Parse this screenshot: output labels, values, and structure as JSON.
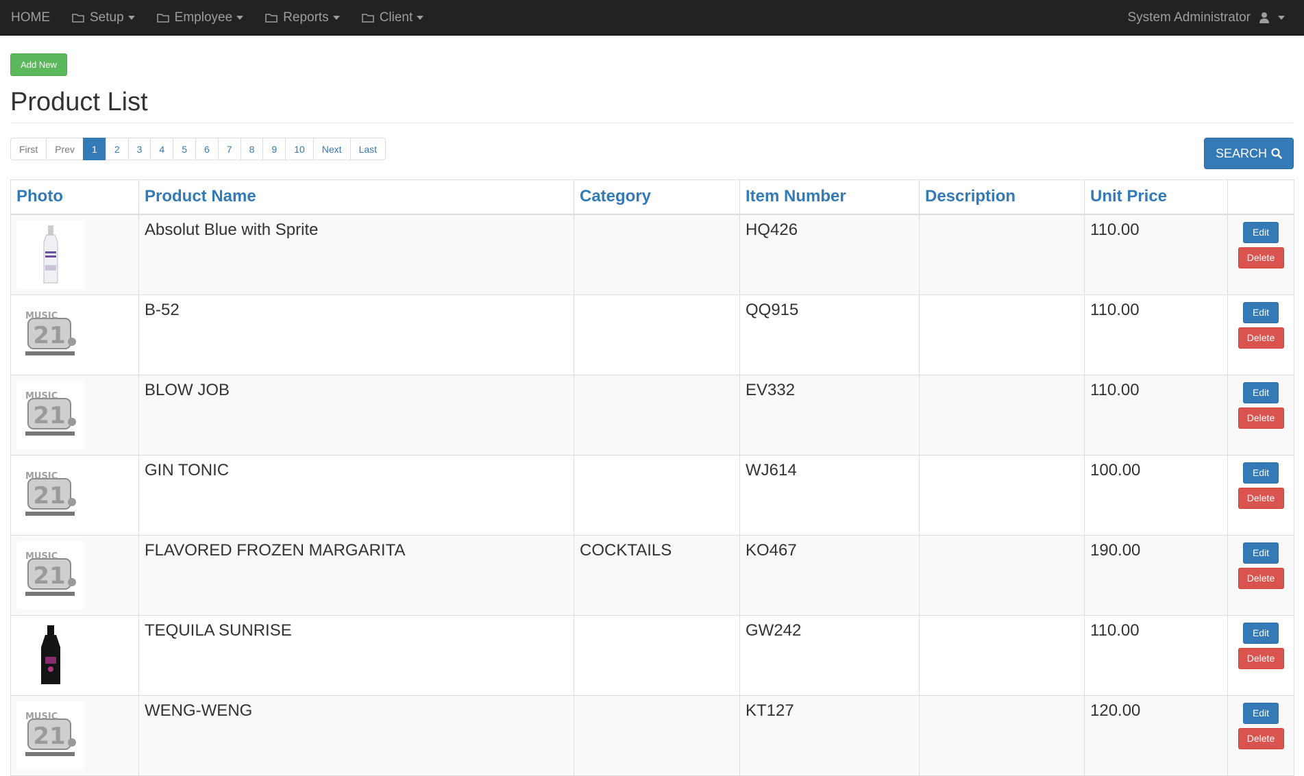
{
  "nav": {
    "home": "HOME",
    "menus": [
      "Setup",
      "Employee",
      "Reports",
      "Client"
    ],
    "user": "System Administrator"
  },
  "add_new": "Add New",
  "page_title": "Product List",
  "pagination": [
    "First",
    "Prev",
    "1",
    "2",
    "3",
    "4",
    "5",
    "6",
    "7",
    "8",
    "9",
    "10",
    "Next",
    "Last"
  ],
  "active_page": "1",
  "search_label": "SEARCH",
  "table": {
    "headers": [
      "Photo",
      "Product Name",
      "Category",
      "Item Number",
      "Description",
      "Unit Price"
    ],
    "rows": [
      {
        "photo": "vodka-bottle",
        "name": "Absolut Blue with Sprite",
        "category": "",
        "item": "HQ426",
        "description": "",
        "price": "110.00"
      },
      {
        "photo": "music21-logo",
        "name": "B-52",
        "category": "",
        "item": "QQ915",
        "description": "",
        "price": "110.00"
      },
      {
        "photo": "music21-logo",
        "name": "BLOW JOB",
        "category": "",
        "item": "EV332",
        "description": "",
        "price": "110.00"
      },
      {
        "photo": "music21-logo",
        "name": "GIN TONIC",
        "category": "",
        "item": "WJ614",
        "description": "",
        "price": "100.00"
      },
      {
        "photo": "music21-logo",
        "name": "FLAVORED FROZEN MARGARITA",
        "category": "COCKTAILS",
        "item": "KO467",
        "description": "",
        "price": "190.00"
      },
      {
        "photo": "tequila-bottle",
        "name": "TEQUILA SUNRISE",
        "category": "",
        "item": "GW242",
        "description": "",
        "price": "110.00"
      },
      {
        "photo": "music21-logo",
        "name": "WENG-WENG",
        "category": "",
        "item": "KT127",
        "description": "",
        "price": "120.00"
      }
    ],
    "edit_label": "Edit",
    "delete_label": "Delete"
  },
  "colors": {
    "navbar": "#222222",
    "primary": "#337ab7",
    "success": "#5cb85c",
    "danger": "#d9534f"
  }
}
